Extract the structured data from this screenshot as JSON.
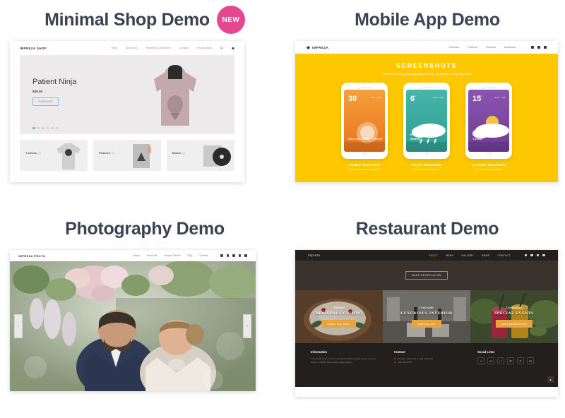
{
  "demos": {
    "shop": {
      "title": "Minimal Shop Demo",
      "badge": "NEW",
      "logo": "IMPREZA SHOP",
      "nav": [
        "Shop",
        "About us",
        "Payment & Delivery",
        "Contact",
        "My Account"
      ],
      "hero": {
        "product": "Patient Ninja",
        "price": "$39.00",
        "button": "VIEW MORE"
      },
      "categories": [
        {
          "label": "T-shirts",
          "count": "(5)"
        },
        {
          "label": "Posters",
          "count": "(3)"
        },
        {
          "label": "Music",
          "count": "(4)"
        }
      ]
    },
    "mobile": {
      "title": "Mobile App Demo",
      "logo": "IMPREZA",
      "nav": [
        "Overview",
        "Features",
        "Reviews",
        "Download"
      ],
      "heading": "SCREENSHOTS",
      "subheading": "Free demo for the gui of the app pages looks like. You are free to change the design",
      "phones": [
        {
          "temp": "30",
          "deg": "°",
          "meta": "7.1% ∙ 4 mph",
          "caption": "HELLISH HEAT TODAY",
          "color": "#f08a2c",
          "color2": "#e9731d"
        },
        {
          "temp": "6",
          "deg": "°",
          "meta": "5.3% ∙ 8 mph",
          "caption": "RAINY DAY KEEP WARM",
          "color": "#3fb0a4",
          "color2": "#2f9d92"
        },
        {
          "temp": "15",
          "deg": "°",
          "meta": "3.2% ∙ 6 mph",
          "caption": "OH, IT'S CLOUDY TODAY",
          "color": "#7f4aa5",
          "color2": "#6e3d94"
        }
      ],
      "captions": [
        {
          "title": "SUNNY WEATHER",
          "desc": "When the weather sunny background"
        },
        {
          "title": "RAINY WEATHER",
          "desc": "When the rain covers the screen"
        },
        {
          "title": "CLOUDY WEATHER",
          "desc": "And it looks warm, but clouds"
        }
      ]
    },
    "photography": {
      "title": "Photography Demo",
      "logo": "IMPREZA PHOTO",
      "nav": [
        "Works",
        "About Me",
        "Service & Price",
        "FAQ",
        "Contact"
      ],
      "arrow_left": "‹",
      "arrow_right": "›"
    },
    "restaurant": {
      "title": "Restaurant Demo",
      "logo": "Impreza",
      "nav": [
        "ABOUT",
        "MENU",
        "GALLERY",
        "NEWS",
        "CONTACT"
      ],
      "hero_button": "MAKE RESERVATION",
      "cards": [
        {
          "script": "Exquisite",
          "title": "DELICIOUS CUISINE",
          "button": "CHECK OUR MENU"
        },
        {
          "script": "Comfortable",
          "title": "LUXURIOUS INTERIOR",
          "button": "VIEW GALLERY"
        },
        {
          "script": "Unforgettable",
          "title": "SPECIAL EVENTS",
          "button": "MAKE RESERVATION"
        }
      ],
      "footer": {
        "info_title": "Information",
        "info_text": "Lorem ipsum dolor sit amet, consectetur adipiscing elit, sed do eiusmod tempor incididunt labore dolore magna aliqua.",
        "contact_title": "Contact",
        "address": "Brooklyn, Boulevard st., 234, New York",
        "phone": "+012 345 6789",
        "social_title": "Social Links",
        "socials": [
          "f",
          "G",
          "□",
          "✆",
          "P",
          "✉"
        ],
        "to_top": "▲"
      }
    }
  },
  "colors": {
    "badge_pink": "#e6488f",
    "app_yellow": "#fdc800",
    "restaurant_orange": "#e8a33d",
    "restaurant_dark": "#231f1d",
    "title_gray": "#3b4252"
  }
}
